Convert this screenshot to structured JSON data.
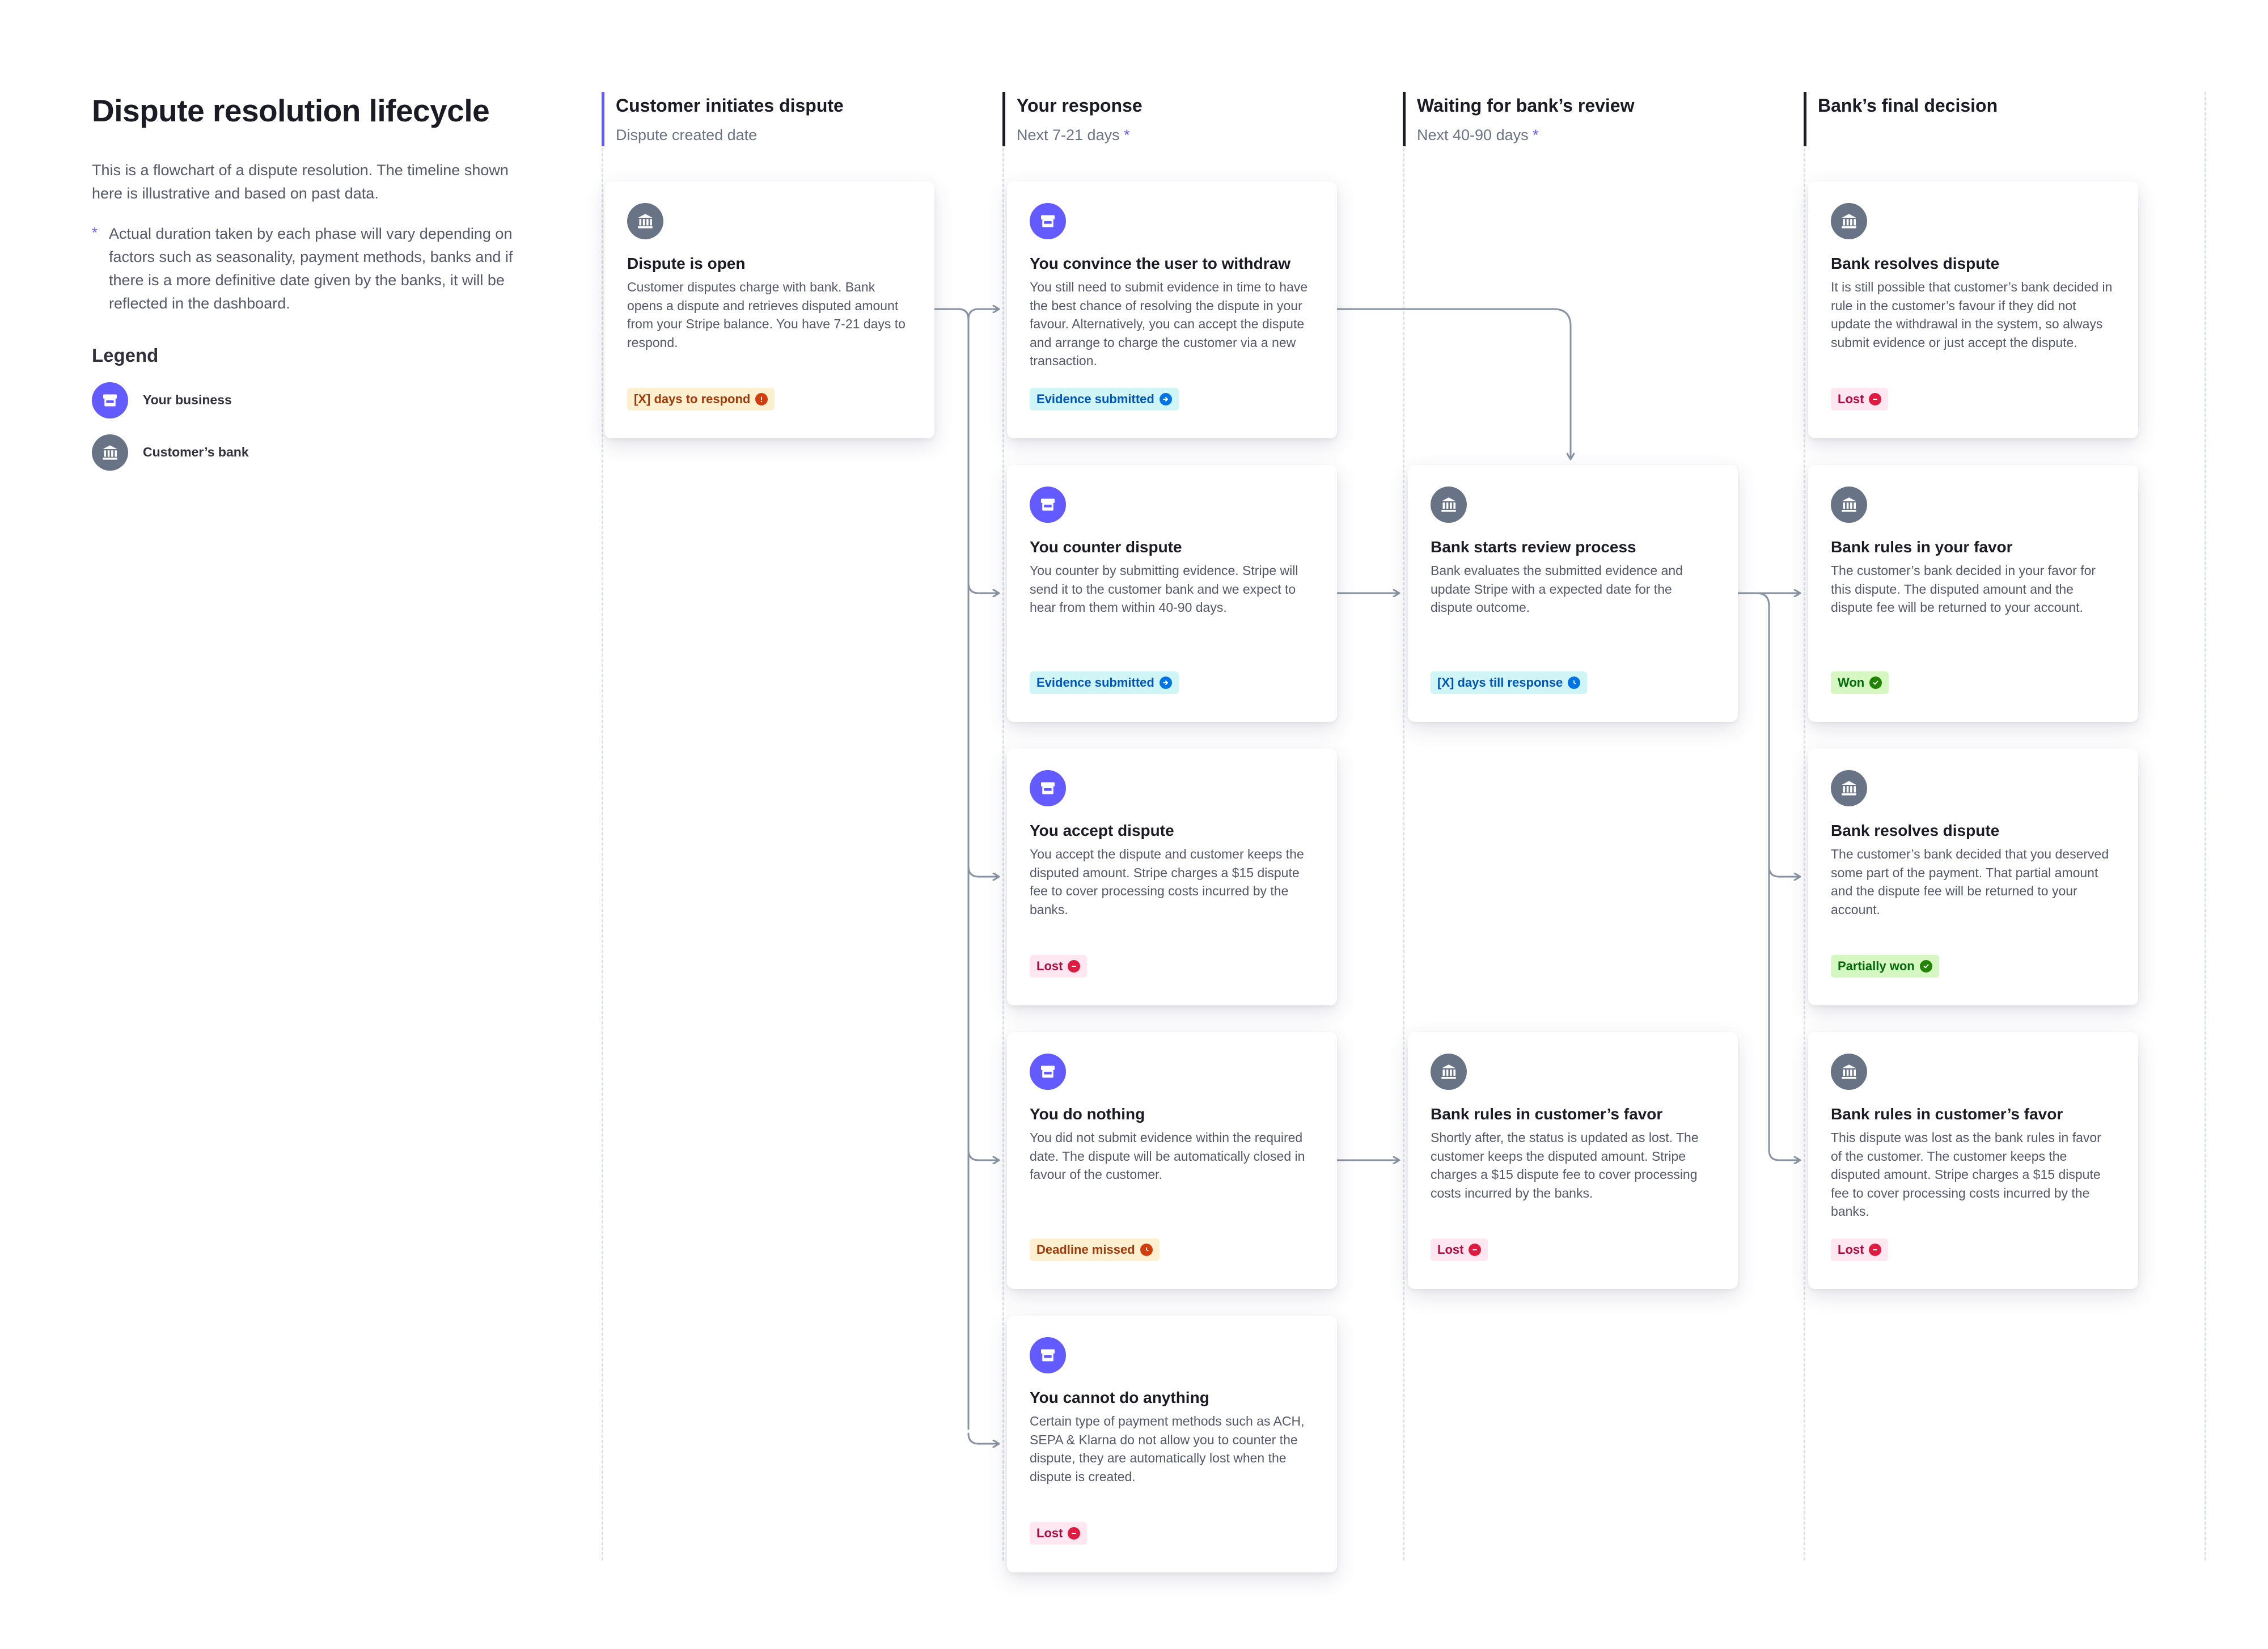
{
  "intro": {
    "title": "Dispute resolution lifecycle",
    "description": "This is a flowchart of a dispute resolution. The timeline shown here is illustrative and based on past data.",
    "note_marker": "*",
    "note": "Actual duration taken by each phase will vary depending on factors such as seasonality, payment methods, banks and if there is a more definitive date given by the banks, it will be reflected in the dashboard.",
    "legend_title": "Legend",
    "legend": [
      {
        "icon": "store-icon",
        "label": "Your business"
      },
      {
        "icon": "bank-icon",
        "label": "Customer’s bank"
      }
    ]
  },
  "columns": [
    {
      "title": "Customer initiates dispute",
      "subtitle": "Dispute created date",
      "marker": ""
    },
    {
      "title": "Your response",
      "subtitle": "Next 7-21 days",
      "marker": "*"
    },
    {
      "title": "Waiting for bank’s review",
      "subtitle": "Next 40-90 days",
      "marker": "*"
    },
    {
      "title": "Bank’s final decision",
      "subtitle": "",
      "marker": ""
    }
  ],
  "cards": {
    "dispute_open": {
      "actor": "bank",
      "title": "Dispute is open",
      "description": "Customer disputes charge with bank. Bank opens a dispute and retrieves disputed amount from your Stripe balance. You have 7-21 days to respond.",
      "tag": "[X] days to respond",
      "tag_style": "orange",
      "tag_icon": "alert-icon"
    },
    "convince_withdraw": {
      "actor": "business",
      "title": "You convince the user to withdraw",
      "description": "You still need to submit evidence in time to have the best chance of resolving the dispute in your favour. Alternatively, you can accept the dispute and arrange to charge the customer via a new transaction.",
      "tag": "Evidence submitted",
      "tag_style": "blue",
      "tag_icon": "arrow-right-icon"
    },
    "counter_dispute": {
      "actor": "business",
      "title": "You counter dispute",
      "description": "You counter by submitting evidence. Stripe will send it to the customer bank and we expect to hear from them within 40-90 days.",
      "tag": "Evidence submitted",
      "tag_style": "blue",
      "tag_icon": "arrow-right-icon"
    },
    "accept_dispute": {
      "actor": "business",
      "title": "You accept dispute",
      "description": "You accept the dispute and customer keeps the disputed amount. Stripe charges a $15 dispute fee to cover processing costs incurred by the banks.",
      "tag": "Lost",
      "tag_style": "red",
      "tag_icon": "minus-icon"
    },
    "do_nothing": {
      "actor": "business",
      "title": "You do nothing",
      "description": "You did not submit evidence within the required date. The dispute will be automatically closed in favour of the customer.",
      "tag": "Deadline missed",
      "tag_style": "orange",
      "tag_icon": "clock-icon"
    },
    "cannot_do_anything": {
      "actor": "business",
      "title": "You cannot do anything",
      "description": "Certain type of payment methods such as ACH, SEPA & Klarna do not allow you to counter the dispute, they are automatically lost when the dispute is created.",
      "tag": "Lost",
      "tag_style": "red",
      "tag_icon": "minus-icon"
    },
    "review_process": {
      "actor": "bank",
      "title": "Bank starts review process",
      "description": "Bank evaluates the submitted evidence and update Stripe with a expected date for the dispute outcome.",
      "tag": "[X] days till response",
      "tag_style": "blue",
      "tag_icon": "clock-icon"
    },
    "rules_customer_mid": {
      "actor": "bank",
      "title": "Bank rules in customer’s favor",
      "description": "Shortly after, the status is updated as lost. The customer keeps the disputed amount. Stripe charges a $15 dispute fee to cover processing costs incurred by the banks.",
      "tag": "Lost",
      "tag_style": "red",
      "tag_icon": "minus-icon"
    },
    "resolves_lost": {
      "actor": "bank",
      "title": "Bank resolves dispute",
      "description": "It is still possible that customer’s bank decided in rule in the customer’s favour if they did not update the withdrawal in the system, so always submit evidence or just accept the dispute.",
      "tag": "Lost",
      "tag_style": "red",
      "tag_icon": "minus-icon"
    },
    "rules_your_favor": {
      "actor": "bank",
      "title": "Bank rules in your favor",
      "description": "The customer’s bank decided in your favor for this dispute. The disputed amount and the dispute fee will be returned to your account.",
      "tag": "Won",
      "tag_style": "green",
      "tag_icon": "check-icon"
    },
    "resolves_partial": {
      "actor": "bank",
      "title": "Bank resolves dispute",
      "description": "The customer’s bank decided that you deserved some part of the payment. That partial amount and the dispute fee will be returned to your account.",
      "tag": "Partially won",
      "tag_style": "green",
      "tag_icon": "check-icon"
    },
    "rules_customer_final": {
      "actor": "bank",
      "title": "Bank rules in customer’s favor",
      "description": "This dispute was lost as the bank rules in favor of the customer. The customer keeps the disputed amount. Stripe charges a $15 dispute fee to cover processing costs incurred by the banks.",
      "tag": "Lost",
      "tag_style": "red",
      "tag_icon": "minus-icon"
    }
  },
  "colors": {
    "business": "#635bff",
    "bank": "#697386",
    "connector": "#8792a2",
    "accent": "#625afa"
  }
}
